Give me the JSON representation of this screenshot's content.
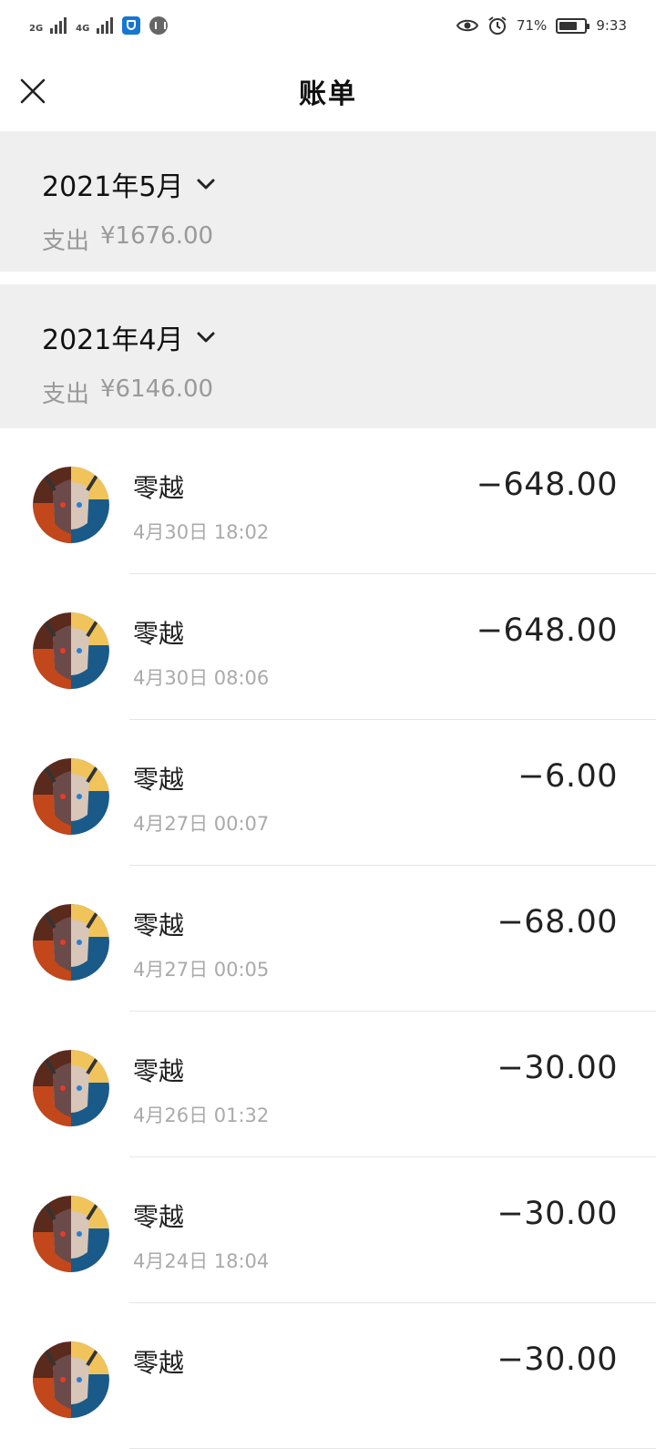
{
  "status_bar": {
    "network_1": "2G",
    "network_2": "4G",
    "battery": "71%",
    "time": "9:33",
    "icons": [
      "signal-icon",
      "signal-icon",
      "security-icon",
      "voice-icon",
      "eye-icon",
      "alarm-icon",
      "battery-icon"
    ]
  },
  "nav": {
    "title": "账单",
    "close_icon": "close-icon"
  },
  "months": [
    {
      "label": "2021年5月",
      "summary_label": "支出",
      "summary_amount": "¥1676.00"
    },
    {
      "label": "2021年4月",
      "summary_label": "支出",
      "summary_amount": "¥6146.00"
    }
  ],
  "transactions": [
    {
      "name": "零越",
      "time": "4月30日 18:02",
      "amount": "−648.00"
    },
    {
      "name": "零越",
      "time": "4月30日 08:06",
      "amount": "−648.00"
    },
    {
      "name": "零越",
      "time": "4月27日 00:07",
      "amount": "−6.00"
    },
    {
      "name": "零越",
      "time": "4月27日 00:05",
      "amount": "−68.00"
    },
    {
      "name": "零越",
      "time": "4月26日 01:32",
      "amount": "−30.00"
    },
    {
      "name": "零越",
      "time": "4月24日 18:04",
      "amount": "−30.00"
    },
    {
      "name": "零越",
      "time": "",
      "amount": "−30.00"
    }
  ]
}
